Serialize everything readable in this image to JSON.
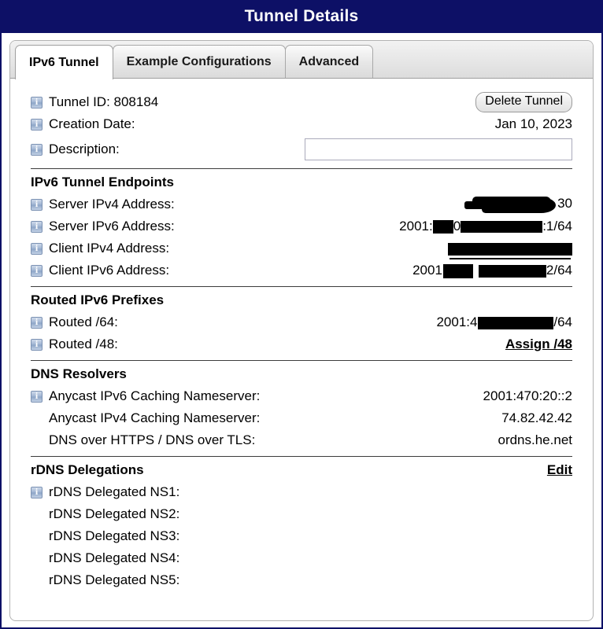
{
  "window": {
    "title": "Tunnel Details"
  },
  "tabs": [
    {
      "label": "IPv6 Tunnel",
      "active": true
    },
    {
      "label": "Example Configurations",
      "active": false
    },
    {
      "label": "Advanced",
      "active": false
    }
  ],
  "summary": {
    "tunnel_id_label": "Tunnel ID: 808184",
    "delete_button": "Delete Tunnel",
    "creation_date_label": "Creation Date:",
    "creation_date_value": "Jan 10, 2023",
    "description_label": "Description:",
    "description_value": "",
    "description_placeholder": ""
  },
  "endpoints": {
    "heading": "IPv6 Tunnel Endpoints",
    "rows": [
      {
        "label": "Server IPv4 Address:",
        "value_prefix": "",
        "value_suffix": "30",
        "redacted": "blob"
      },
      {
        "label": "Server IPv6 Address:",
        "value_prefix": "2001:",
        "value_suffix": ":1/64",
        "redacted": "bar"
      },
      {
        "label": "Client IPv4 Address:",
        "value_prefix": "",
        "value_suffix": "",
        "redacted": "bar-underline"
      },
      {
        "label": "Client IPv6 Address:",
        "value_prefix": "2001",
        "value_suffix": "2/64",
        "redacted": "bar-split"
      }
    ]
  },
  "routed": {
    "heading": "Routed IPv6 Prefixes",
    "rows": [
      {
        "label": "Routed /64:",
        "value_prefix": "2001:470",
        "value_suffix": "/64",
        "redacted": "bar"
      },
      {
        "label": "Routed /48:",
        "link": "Assign /48"
      }
    ]
  },
  "dns": {
    "heading": "DNS Resolvers",
    "rows": [
      {
        "label": "Anycast IPv6 Caching Nameserver:",
        "value": "2001:470:20::2",
        "icon": true
      },
      {
        "label": "Anycast IPv4 Caching Nameserver:",
        "value": "74.82.42.42",
        "icon": false
      },
      {
        "label": "DNS over HTTPS / DNS over TLS:",
        "value": "ordns.he.net",
        "icon": false
      }
    ]
  },
  "rdns": {
    "heading": "rDNS Delegations",
    "edit_link": "Edit",
    "rows": [
      {
        "label": "rDNS Delegated NS1:",
        "value": "",
        "icon": true
      },
      {
        "label": "rDNS Delegated NS2:",
        "value": "",
        "icon": false
      },
      {
        "label": "rDNS Delegated NS3:",
        "value": "",
        "icon": false
      },
      {
        "label": "rDNS Delegated NS4:",
        "value": "",
        "icon": false
      },
      {
        "label": "rDNS Delegated NS5:",
        "value": "",
        "icon": false
      }
    ]
  },
  "colors": {
    "titlebar": "#0d1066",
    "titlebar_text": "#ffffff",
    "panel_bg": "#ffffff",
    "redaction": "#000000"
  }
}
